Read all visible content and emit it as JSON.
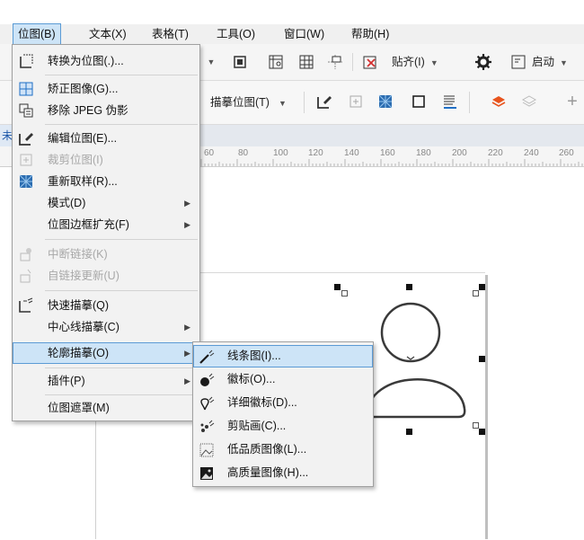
{
  "menubar": {
    "items": [
      {
        "label": "位图(B)",
        "active": true
      },
      {
        "label": "文本(X)"
      },
      {
        "label": "表格(T)"
      },
      {
        "label": "工具(O)"
      },
      {
        "label": "窗口(W)"
      },
      {
        "label": "帮助(H)"
      }
    ]
  },
  "toolbar": {
    "snap_label": "贴齐(I)",
    "launch_label": "启动",
    "trace_bitmap_label": "描摹位图(T)"
  },
  "document_tab": {
    "label": "未"
  },
  "ruler": {
    "ticks": [
      "60",
      "80",
      "100",
      "120",
      "140",
      "160",
      "180",
      "200",
      "220",
      "240",
      "260"
    ]
  },
  "bitmap_menu": {
    "items": [
      {
        "label": "转换为位图(.)...",
        "icon": "convert-to-bitmap-icon",
        "enabled": true
      },
      {
        "label": "矫正图像(G)...",
        "icon": "straighten-image-icon",
        "enabled": true
      },
      {
        "label": "移除 JPEG 伪影",
        "icon": "remove-jpeg-artifacts-icon",
        "enabled": true
      },
      {
        "label": "编辑位图(E)...",
        "icon": "edit-bitmap-icon",
        "enabled": true
      },
      {
        "label": "裁剪位图(I)",
        "icon": "crop-bitmap-icon",
        "enabled": false
      },
      {
        "label": "重新取样(R)...",
        "icon": "resample-icon",
        "enabled": true
      },
      {
        "label": "模式(D)",
        "icon": "",
        "enabled": true,
        "submenu": true
      },
      {
        "label": "位图边框扩充(F)",
        "icon": "",
        "enabled": true,
        "submenu": true
      },
      {
        "label": "中断链接(K)",
        "icon": "break-link-icon",
        "enabled": false
      },
      {
        "label": "自链接更新(U)",
        "icon": "update-link-icon",
        "enabled": false
      },
      {
        "label": "快速描摹(Q)",
        "icon": "quick-trace-icon",
        "enabled": true
      },
      {
        "label": "中心线描摹(C)",
        "icon": "",
        "enabled": true,
        "submenu": true
      },
      {
        "label": "轮廓描摹(O)",
        "icon": "",
        "enabled": true,
        "submenu": true,
        "highlighted": true
      },
      {
        "label": "插件(P)",
        "icon": "",
        "enabled": true,
        "submenu": true
      },
      {
        "label": "位图遮罩(M)",
        "icon": "",
        "enabled": true
      }
    ]
  },
  "outline_trace_submenu": {
    "items": [
      {
        "label": "线条图(I)...",
        "icon": "line-art-icon",
        "highlighted": true
      },
      {
        "label": "徽标(O)...",
        "icon": "logo-icon"
      },
      {
        "label": "详细徽标(D)...",
        "icon": "detailed-logo-icon"
      },
      {
        "label": "剪贴画(C)...",
        "icon": "clipart-icon"
      },
      {
        "label": "低品质图像(L)...",
        "icon": "low-quality-image-icon"
      },
      {
        "label": "高质量图像(H)...",
        "icon": "high-quality-image-icon"
      }
    ]
  },
  "colors": {
    "highlight_bg": "#cde4f7",
    "highlight_border": "#5b9bd5",
    "menu_bg": "#f2f2f2",
    "icon_blue": "#1f6fc5"
  }
}
